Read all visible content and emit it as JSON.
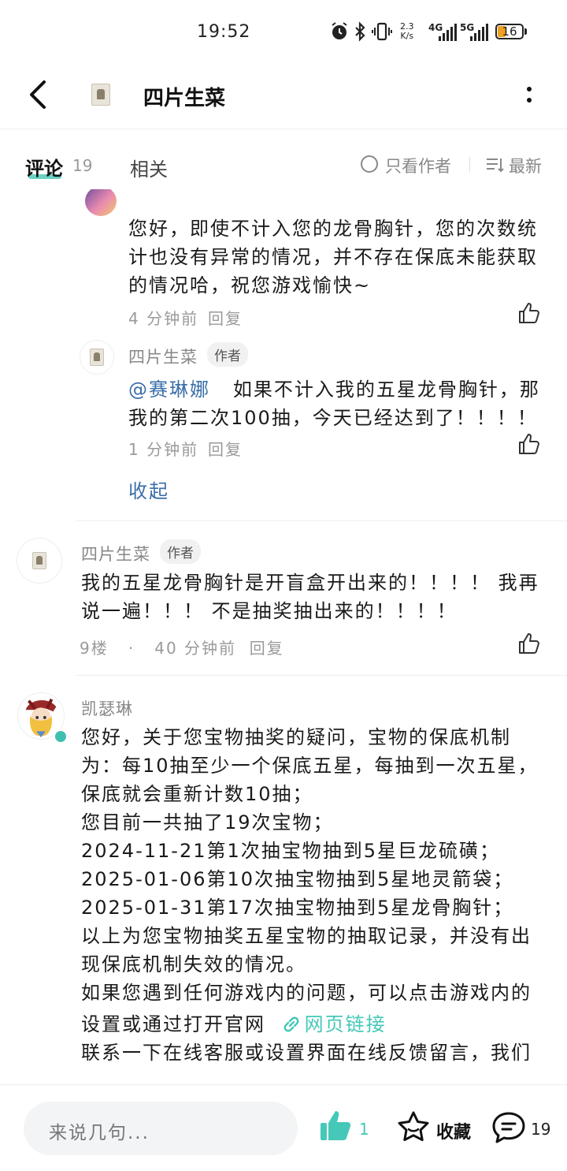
{
  "status_bar": {
    "time": "19:52",
    "net_speed_top": "2.3",
    "net_speed_bottom": "K/s",
    "signal1": "4G",
    "signal2": "5G",
    "battery": "16"
  },
  "header": {
    "title": "四片生菜"
  },
  "tabs": {
    "comments_label": "评论",
    "comments_count": "19",
    "related_label": "相关",
    "author_only_label": "只看作者",
    "sort_label": "最新"
  },
  "reply_cut": {
    "text": "您好，即使不计入您的龙骨胸针，您的次数统计也没有异常的情况，并不存在保底未能获取的情况哈，祝您游戏愉快~",
    "time": "4 分钟前",
    "reply_label": "回复"
  },
  "reply_author": {
    "name": "四片生菜",
    "badge": "作者",
    "mention": "@赛琳娜",
    "text": "如果不计入我的五星龙骨胸针，那我的第二次100抽，今天已经达到了！！！！",
    "time": "1 分钟前",
    "reply_label": "回复"
  },
  "collapse_label": "收起",
  "comment_9": {
    "name": "四片生菜",
    "badge": "作者",
    "text": "我的五星龙骨胸针是开盲盒开出来的！！！！ 我再说一遍！！！ 不是抽奖抽出来的！！！！",
    "floor": "9楼",
    "dot": "·",
    "time": "40 分钟前",
    "reply_label": "回复"
  },
  "comment_kai": {
    "name": "凯瑟琳",
    "lines": [
      "您好，关于您宝物抽奖的疑问，宝物的保底机制为：每10抽至少一个保底五星，每抽到一次五星，保底就会重新计数10抽；",
      "您目前一共抽了19次宝物；",
      "2024-11-21第1次抽宝物抽到5星巨龙硫磺；",
      "2025-01-06第10次抽宝物抽到5星地灵箭袋；",
      "2025-01-31第17次抽宝物抽到5星龙骨胸针；",
      "以上为您宝物抽奖五星宝物的抽取记录，并没有出现保底机制失效的情况。",
      "如果您遇到任何游戏内的问题，可以点击游戏内的"
    ],
    "link_prefix": "设置或通过打开官网",
    "link_label": "网页链接",
    "last_line": "联系一下在线客服或设置界面在线反馈留言，我们"
  },
  "bottom_bar": {
    "input_placeholder": "来说几句...",
    "like_count": "1",
    "favorite_label": "收藏",
    "comment_count": "19"
  },
  "colors": {
    "accent": "#45c8b8",
    "link_blue": "#3a6ea8",
    "meta_gray": "#9a9a9a"
  },
  "icons": [
    "back-icon",
    "more-icon",
    "author-only-icon",
    "sort-icon",
    "thumbs-up-icon",
    "star-icon",
    "comment-bubble-icon",
    "link-icon",
    "verified-icon"
  ]
}
